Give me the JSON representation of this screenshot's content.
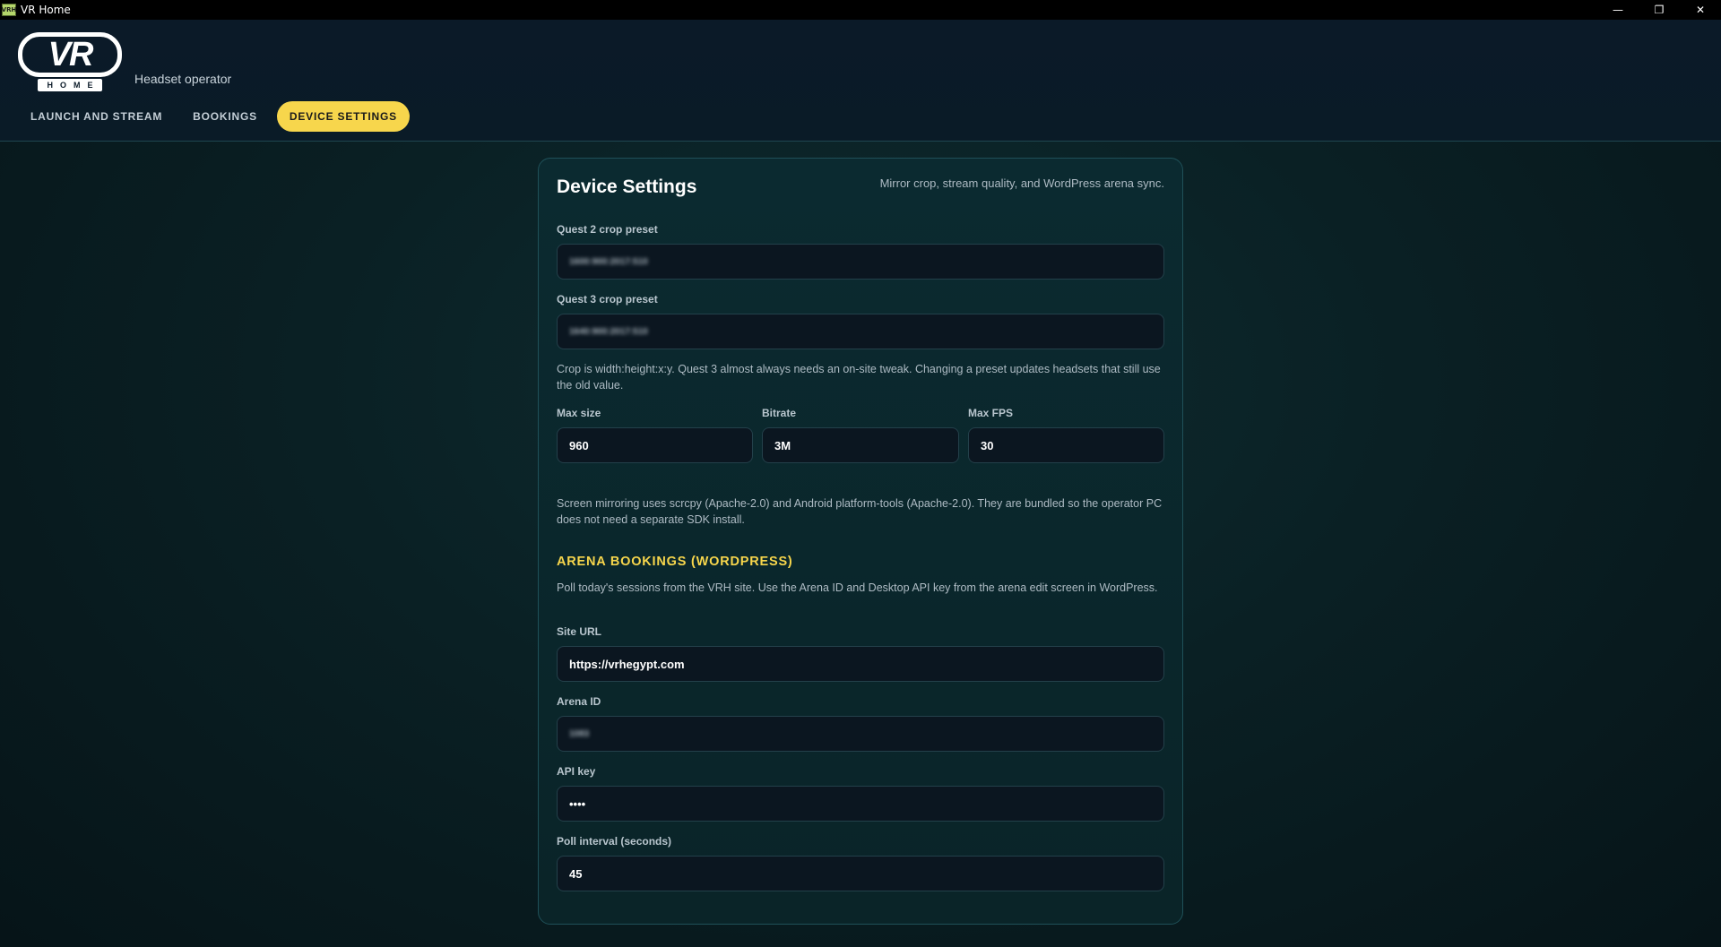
{
  "window": {
    "title": "VR Home",
    "icon_text": "VRH",
    "minimize": "—",
    "restore": "❐",
    "close": "✕"
  },
  "header": {
    "logo_text": "VR",
    "logo_sub": "HOME",
    "role_label": "Headset operator",
    "tabs": [
      {
        "label": "LAUNCH AND STREAM",
        "active": false
      },
      {
        "label": "BOOKINGS",
        "active": false
      },
      {
        "label": "DEVICE SETTINGS",
        "active": true
      }
    ]
  },
  "device_settings": {
    "title": "Device Settings",
    "subtitle": "Mirror crop, stream quality, and WordPress arena sync.",
    "quest2_label": "Quest 2 crop preset",
    "quest2_value": "1600:900:2017:510",
    "quest3_label": "Quest 3 crop preset",
    "quest3_value": "1640:900:2017:510",
    "crop_help": "Crop is width:height:x:y. Quest 3 almost always needs an on-site tweak. Changing a preset updates headsets that still use the old value.",
    "max_size_label": "Max size",
    "max_size_value": "960",
    "bitrate_label": "Bitrate",
    "bitrate_value": "3M",
    "max_fps_label": "Max FPS",
    "max_fps_value": "30",
    "mirroring_help": "Screen mirroring uses scrcpy (Apache-2.0) and Android platform-tools (Apache-2.0). They are bundled so the operator PC does not need a separate SDK install."
  },
  "arena": {
    "title": "ARENA BOOKINGS (WORDPRESS)",
    "help": "Poll today's sessions from the VRH site. Use the Arena ID and Desktop API key from the arena edit screen in WordPress.",
    "site_url_label": "Site URL",
    "site_url_value": "https://vrhegypt.com",
    "arena_id_label": "Arena ID",
    "arena_id_value": "1083",
    "api_key_label": "API key",
    "api_key_value": "••••",
    "poll_label": "Poll interval (seconds)",
    "poll_value": "45"
  },
  "colors": {
    "accent": "#f7d64c",
    "background": "#0a2024",
    "card_border": "#1f5058"
  }
}
